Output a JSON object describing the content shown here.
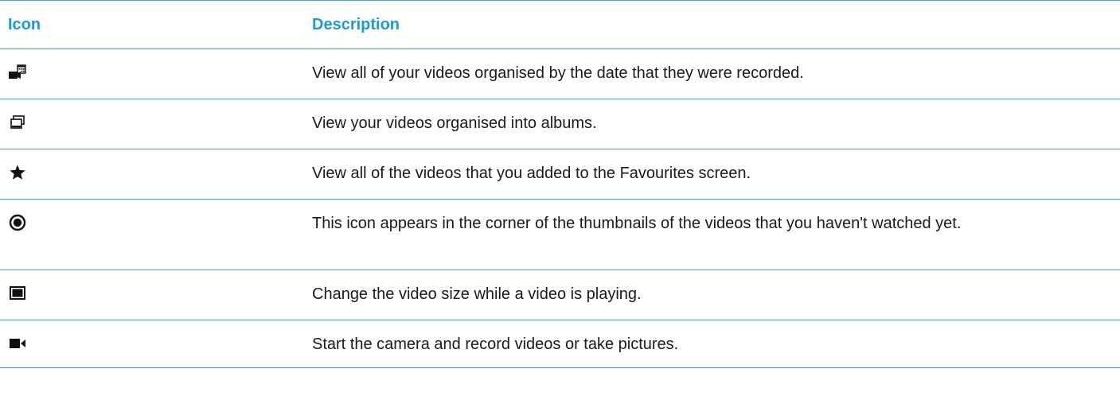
{
  "table": {
    "header": {
      "icon_label": "Icon",
      "description_label": "Description"
    },
    "rows": [
      {
        "icon": "calendar-video-icon",
        "description": "View all of your videos organised by the date that they were recorded."
      },
      {
        "icon": "albums-icon",
        "description": "View your videos organised into albums."
      },
      {
        "icon": "star-icon",
        "description": "View all of the videos that you added to the Favourites screen."
      },
      {
        "icon": "unwatched-dot-icon",
        "description": "This icon appears in the corner of the thumbnails of the videos that you haven't watched yet."
      },
      {
        "icon": "video-size-icon",
        "description": "Change the video size while a video is playing."
      },
      {
        "icon": "video-camera-icon",
        "description": "Start the camera and record videos or take pictures."
      }
    ]
  },
  "colors": {
    "accent": "#1a9ad6",
    "rule": "#38a8d8",
    "text": "#1a1a1a"
  }
}
